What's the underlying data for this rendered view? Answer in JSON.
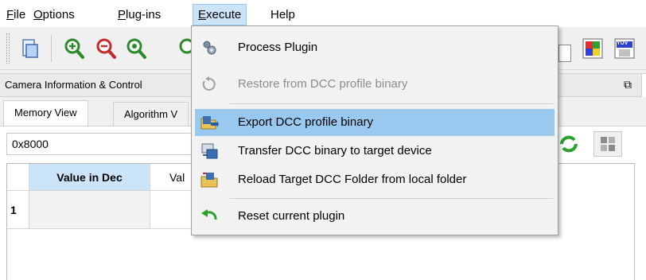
{
  "menubar": {
    "items": [
      {
        "label": "File",
        "mnemonic": "F",
        "rest": "ile"
      },
      {
        "label": "Options",
        "mnemonic": "O",
        "rest": "ptions"
      },
      {
        "label": "Plug-ins",
        "mnemonic": "P",
        "rest": "lug-ins"
      },
      {
        "label": "Execute",
        "mnemonic": "E",
        "rest": "xecute"
      },
      {
        "label": "Help",
        "mnemonic": "",
        "rest": "Help"
      }
    ]
  },
  "execute_menu": {
    "items": [
      {
        "label": "Process Plugin",
        "icon": "gear-icon",
        "enabled": true
      },
      {
        "label": "Restore from DCC profile binary",
        "icon": "restore-icon",
        "enabled": false
      },
      {
        "label": "Export DCC profile binary",
        "icon": "export-folder-icon",
        "enabled": true,
        "highlighted": true
      },
      {
        "label": "Transfer DCC binary to target device",
        "icon": "transfer-device-icon",
        "enabled": true
      },
      {
        "label": "Reload Target DCC Folder from local folder",
        "icon": "reload-folder-icon",
        "enabled": true
      },
      {
        "label": "Reset current plugin",
        "icon": "reset-arrow-icon",
        "enabled": true
      }
    ]
  },
  "toolbar": {
    "buttons": [
      "document-icon",
      "zoom-in-icon",
      "zoom-out-icon",
      "zoom-fit-icon",
      "zoom-icon",
      "color-palette-icon",
      "yuv-icon"
    ],
    "yuv_label": "YUV"
  },
  "panel": {
    "title": "Camera Information & Control",
    "float_icon": "float-window-icon"
  },
  "tabs": [
    {
      "label": "Memory View",
      "active": true
    },
    {
      "label": "Algorithm V",
      "active": false
    }
  ],
  "memory": {
    "address_value": "0x8000",
    "columns": [
      "Value in Dec",
      "Val"
    ],
    "rows": [
      {
        "index": "1"
      }
    ]
  },
  "colors": {
    "menu_selected": "#cce4f7",
    "item_highlight": "#99c9ef",
    "disabled_text": "#8c8c8c",
    "table_header_selected": "#cce4f7"
  }
}
